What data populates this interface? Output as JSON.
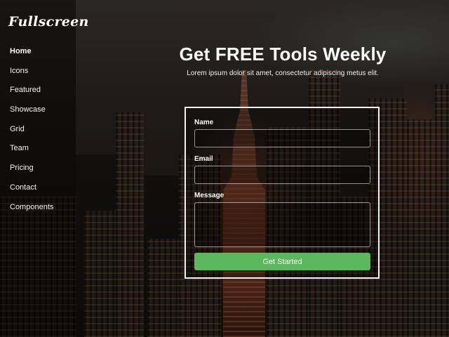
{
  "brand": {
    "name": "Fullscreen"
  },
  "nav": {
    "items": [
      {
        "label": "Home",
        "active": true
      },
      {
        "label": "Icons",
        "active": false
      },
      {
        "label": "Featured",
        "active": false
      },
      {
        "label": "Showcase",
        "active": false
      },
      {
        "label": "Grid",
        "active": false
      },
      {
        "label": "Team",
        "active": false
      },
      {
        "label": "Pricing",
        "active": false
      },
      {
        "label": "Contact",
        "active": false
      },
      {
        "label": "Components",
        "active": false
      }
    ]
  },
  "hero": {
    "title": "Get FREE Tools Weekly",
    "subtitle": "Lorem ipsum dolor sit amet, consectetur adipiscing metus elit."
  },
  "form": {
    "name_label": "Name",
    "name_value": "",
    "email_label": "Email",
    "email_value": "",
    "message_label": "Message",
    "message_value": "",
    "submit_label": "Get Started"
  },
  "colors": {
    "button": "#5cb85c",
    "form_border": "#f2f2f2",
    "text": "#ffffff"
  }
}
